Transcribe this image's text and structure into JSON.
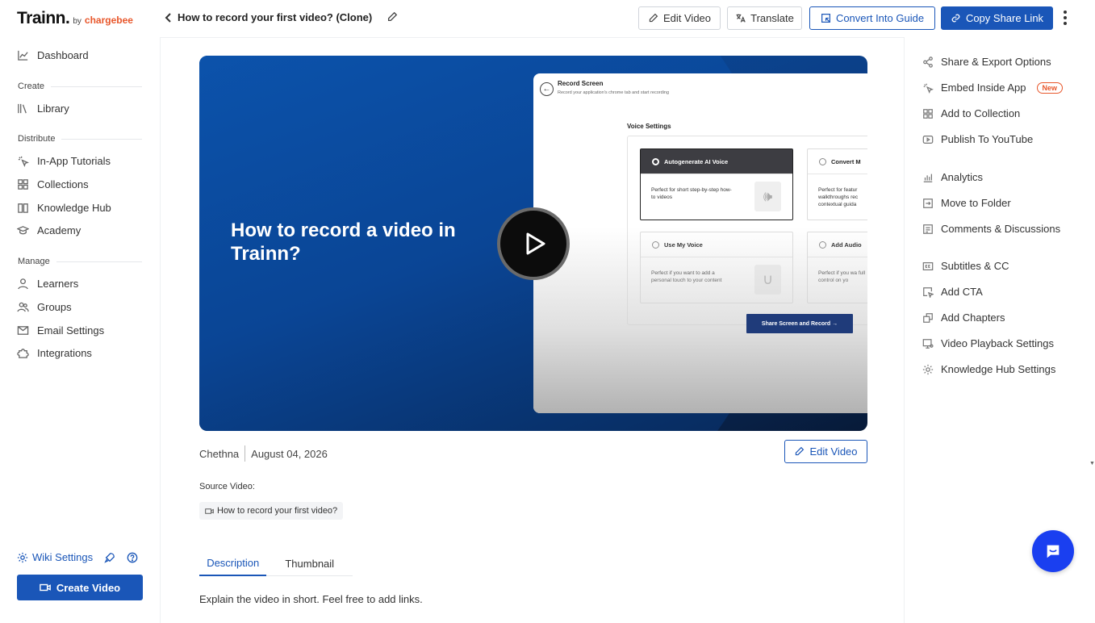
{
  "brand": {
    "name": "Trainn.",
    "by": "by",
    "partner": "chargebee"
  },
  "sidebar": {
    "dashboard": "Dashboard",
    "sections": {
      "create": "Create",
      "distribute": "Distribute",
      "manage": "Manage"
    },
    "create_items": [
      {
        "label": "Library",
        "icon": "library-icon"
      }
    ],
    "distribute_items": [
      {
        "label": "In-App Tutorials",
        "icon": "cursor-click-icon"
      },
      {
        "label": "Collections",
        "icon": "grid-icon"
      },
      {
        "label": "Knowledge Hub",
        "icon": "book-icon"
      },
      {
        "label": "Academy",
        "icon": "graduation-cap-icon"
      }
    ],
    "manage_items": [
      {
        "label": "Learners",
        "icon": "user-icon"
      },
      {
        "label": "Groups",
        "icon": "users-icon"
      },
      {
        "label": "Email Settings",
        "icon": "mail-icon"
      },
      {
        "label": "Integrations",
        "icon": "puzzle-icon"
      }
    ],
    "wiki_settings": "Wiki Settings",
    "create_video": "Create Video"
  },
  "header": {
    "title": "How to record your first video? (Clone)",
    "edit_video": "Edit Video",
    "translate": "Translate",
    "convert": "Convert Into Guide",
    "copy_link": "Copy Share Link"
  },
  "video": {
    "heading": "How to record a video in Trainn?",
    "mock": {
      "title": "Record Screen",
      "subtitle": "Record your application's chrome tab and start recording",
      "voice_settings": "Voice Settings",
      "cards": [
        {
          "title": "Autogenerate AI Voice",
          "body": "Perfect for short step-by-step how-to videos"
        },
        {
          "title": "Convert M",
          "body": "Perfect for featur walkthroughs rec contextual guida"
        },
        {
          "title": "Use My Voice",
          "body": "Perfect if you want to add a personal touch to your content"
        },
        {
          "title": "Add Audio",
          "body": "Perfect if you wa full control on yo"
        }
      ],
      "share_button": "Share Screen and Record →"
    }
  },
  "meta": {
    "author": "Chethna",
    "date": "August 04, 2026",
    "edit_video": "Edit Video",
    "source_label": "Source Video:",
    "source_name": "How to record your first video?"
  },
  "tabs": [
    "Description",
    "Thumbnail"
  ],
  "description_placeholder": "Explain the video in short. Feel free to add links.",
  "right_panel": {
    "items": [
      "Share & Export Options",
      "Embed Inside App",
      "Add to Collection",
      "Publish To YouTube",
      "Analytics",
      "Move to Folder",
      "Comments & Discussions",
      "Subtitles & CC",
      "Add CTA",
      "Add Chapters",
      "Video Playback Settings",
      "Knowledge Hub Settings"
    ],
    "new_badge": "New"
  },
  "colors": {
    "primary": "#1a56b8",
    "accent": "#e8562a",
    "chat": "#1a3ff0"
  }
}
